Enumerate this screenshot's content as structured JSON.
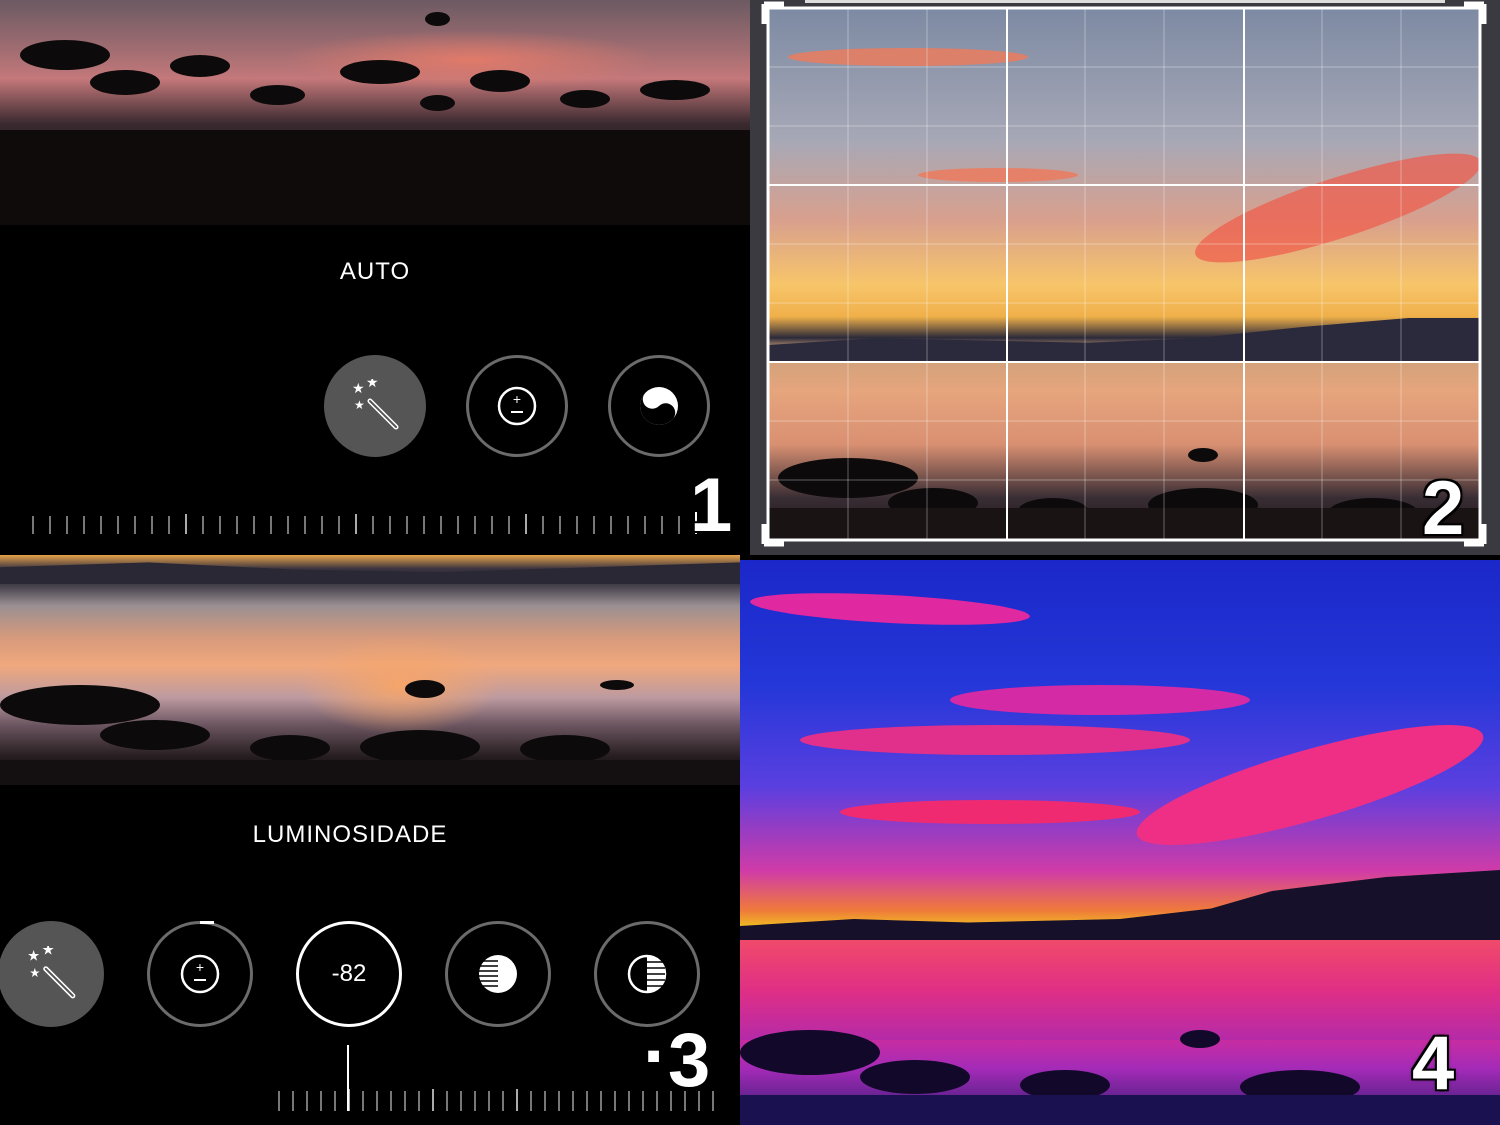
{
  "panel1": {
    "mode_label": "AUTO",
    "tools": [
      {
        "name": "auto-enhance",
        "icon": "magic-wand-icon",
        "state": "active"
      },
      {
        "name": "exposure",
        "icon": "plus-minus-icon",
        "state": "idle"
      },
      {
        "name": "filters",
        "icon": "yin-yang-icon",
        "state": "idle"
      }
    ],
    "step_number": "1"
  },
  "panel2": {
    "step_number": "2",
    "crop_grid": "on"
  },
  "panel3": {
    "mode_label": "LUMINOSIDADE",
    "tools": [
      {
        "name": "auto-enhance",
        "icon": "magic-wand-icon"
      },
      {
        "name": "exposure",
        "icon": "plus-minus-icon"
      },
      {
        "name": "brightness",
        "value": "-82"
      },
      {
        "name": "contrast",
        "icon": "half-circle-striped-icon"
      },
      {
        "name": "black-point",
        "icon": "half-circle-lines-icon"
      }
    ],
    "step_number": "3",
    "step_dot": "·"
  },
  "panel4": {
    "step_number": "4"
  },
  "colors": {
    "ui_background": "#000000",
    "accent": "#ffffff",
    "tool_ring": "#6b6b6b",
    "sunset_orange": "#f08a4b",
    "saturated_magenta": "#e0208a",
    "saturated_blue": "#1f2fd8"
  }
}
